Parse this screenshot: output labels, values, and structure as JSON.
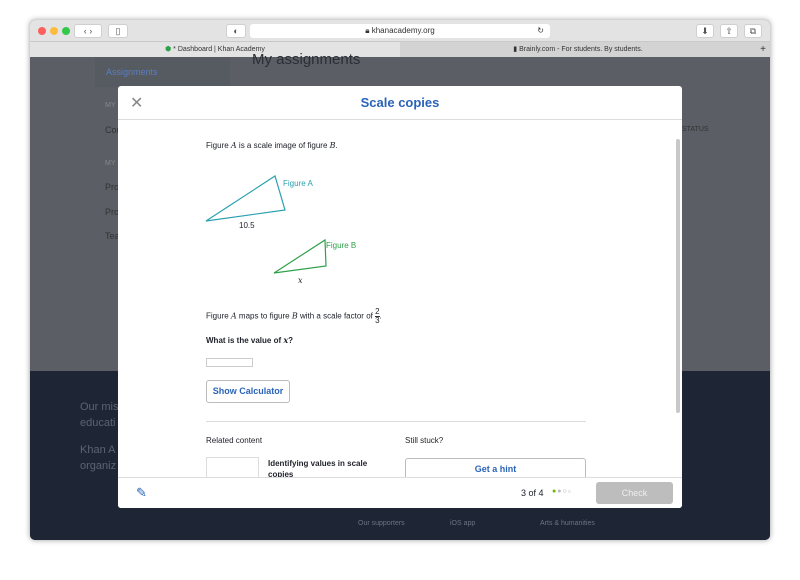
{
  "browser": {
    "url": "khanacademy.org",
    "tabs": [
      {
        "label": "* Dashboard | Khan Academy"
      },
      {
        "label": "Brainly.com - For students. By students."
      }
    ]
  },
  "background": {
    "sidebar_active": "Assignments",
    "page_title": "My assignments",
    "sidebar_fragments": [
      "MY",
      "Cou",
      "MY",
      "Pro",
      "Pro",
      "Tea"
    ],
    "status_header": "STATUS",
    "footer_fragments": [
      "Our mis",
      "educati",
      "Khan A",
      "organiz"
    ],
    "footer_links": [
      "Our supporters",
      "iOS app",
      "Arts & humanities"
    ]
  },
  "modal": {
    "title": "Scale copies",
    "problem": {
      "intro_pre": "Figure ",
      "intro_a": "A",
      "intro_mid": " is a scale image of figure ",
      "intro_b": "B",
      "intro_end": ".",
      "figure_a_label": "Figure A",
      "figure_a_side": "10.5",
      "figure_b_label": "Figure B",
      "figure_b_side": "x",
      "maps_pre": "Figure ",
      "maps_a": "A",
      "maps_mid": " maps to figure ",
      "maps_b": "B",
      "maps_post": " with a scale factor of ",
      "factor_num": "2",
      "factor_den": "3",
      "maps_end": ".",
      "question_pre": "What is the value of ",
      "question_var": "x",
      "question_end": "?",
      "answer_value": ""
    },
    "show_calculator": "Show Calculator",
    "related_heading": "Related content",
    "related_item": "Identifying values in scale copies",
    "stuck_heading": "Still stuck?",
    "hint_button": "Get a hint",
    "progress": "3 of 4",
    "progress_dots": [
      "done",
      "current",
      "todo",
      "todo"
    ],
    "check_button": "Check"
  },
  "colors": {
    "accent": "#2a63b8",
    "figure_a": "#2aa0b0",
    "figure_b": "#2ea04a",
    "progress_done": "#71b307"
  }
}
